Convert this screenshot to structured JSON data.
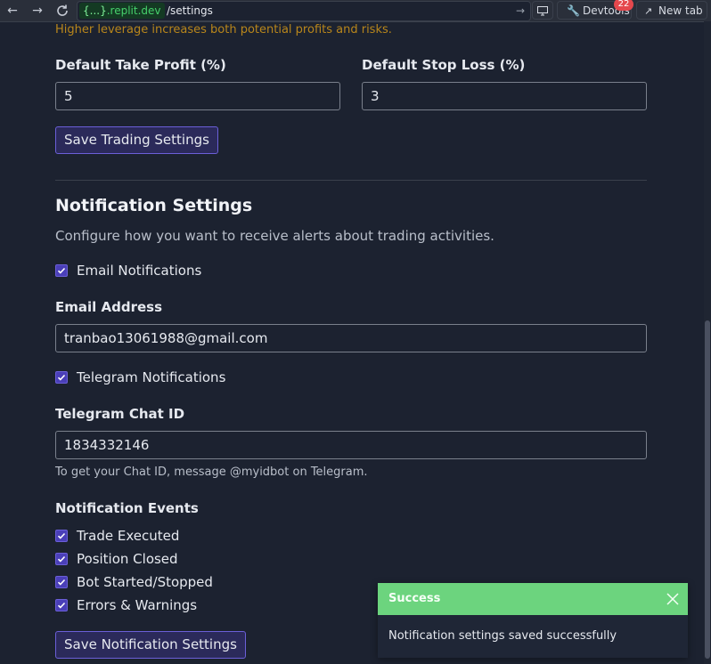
{
  "browser": {
    "domain_prefix": "{...}",
    "domain_suffix": ".replit.dev",
    "path": "/settings",
    "devtools_label": "Devtools",
    "devtools_badge": "22",
    "new_tab_label": "New tab"
  },
  "trading": {
    "leverage_hint": "Higher leverage increases both potential profits and risks.",
    "take_profit_label": "Default Take Profit (%)",
    "take_profit_value": "5",
    "stop_loss_label": "Default Stop Loss (%)",
    "stop_loss_value": "3",
    "save_label": "Save Trading Settings"
  },
  "notifications": {
    "title": "Notification Settings",
    "description": "Configure how you want to receive alerts about trading activities.",
    "email_toggle_label": "Email Notifications",
    "email_toggle_checked": true,
    "email_label": "Email Address",
    "email_value": "tranbao13061988@gmail.com",
    "telegram_toggle_label": "Telegram Notifications",
    "telegram_toggle_checked": true,
    "telegram_label": "Telegram Chat ID",
    "telegram_value": "1834332146",
    "telegram_hint": "To get your Chat ID, message @myidbot on Telegram.",
    "events_label": "Notification Events",
    "events": [
      {
        "label": "Trade Executed",
        "checked": true
      },
      {
        "label": "Position Closed",
        "checked": true
      },
      {
        "label": "Bot Started/Stopped",
        "checked": true
      },
      {
        "label": "Errors & Warnings",
        "checked": true
      }
    ],
    "save_label": "Save Notification Settings"
  },
  "toast": {
    "title": "Success",
    "message": "Notification settings saved successfully"
  },
  "colors": {
    "background": "#1c2230",
    "accent": "#4a3fb8",
    "warning_text": "#b8861b",
    "success": "#6cd47e"
  }
}
